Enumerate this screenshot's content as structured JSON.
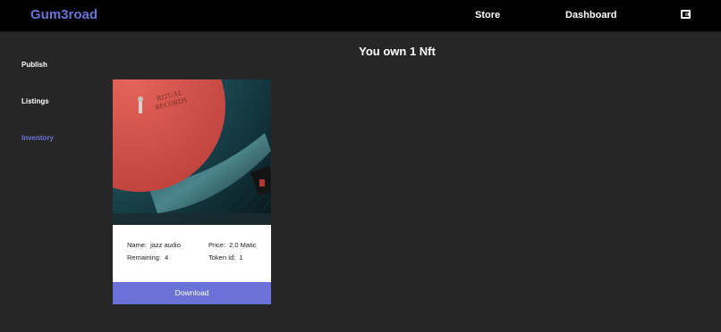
{
  "header": {
    "brand": "Gum3road",
    "nav": {
      "store": "Store",
      "dashboard": "Dashboard"
    },
    "wallet_icon": "wallet-icon"
  },
  "sidebar": {
    "items": [
      {
        "label": "Publish",
        "active": false
      },
      {
        "label": "Listings",
        "active": false
      },
      {
        "label": "Inventory",
        "active": true
      }
    ]
  },
  "main": {
    "title": "You own 1 Nft",
    "cards": [
      {
        "image": "vinyl-record-image",
        "name_label": "Name:",
        "name": "jazz audio",
        "price_label": "Price:",
        "price": "2.0 Matic",
        "remaining_label": "Remaining:",
        "remaining": "4",
        "token_label": "Token Id:",
        "token_id": "1",
        "action": "Download"
      }
    ]
  },
  "colors": {
    "accent": "#6a72d8",
    "background": "#262626",
    "topbar": "#000000",
    "card": "#ffffff"
  }
}
